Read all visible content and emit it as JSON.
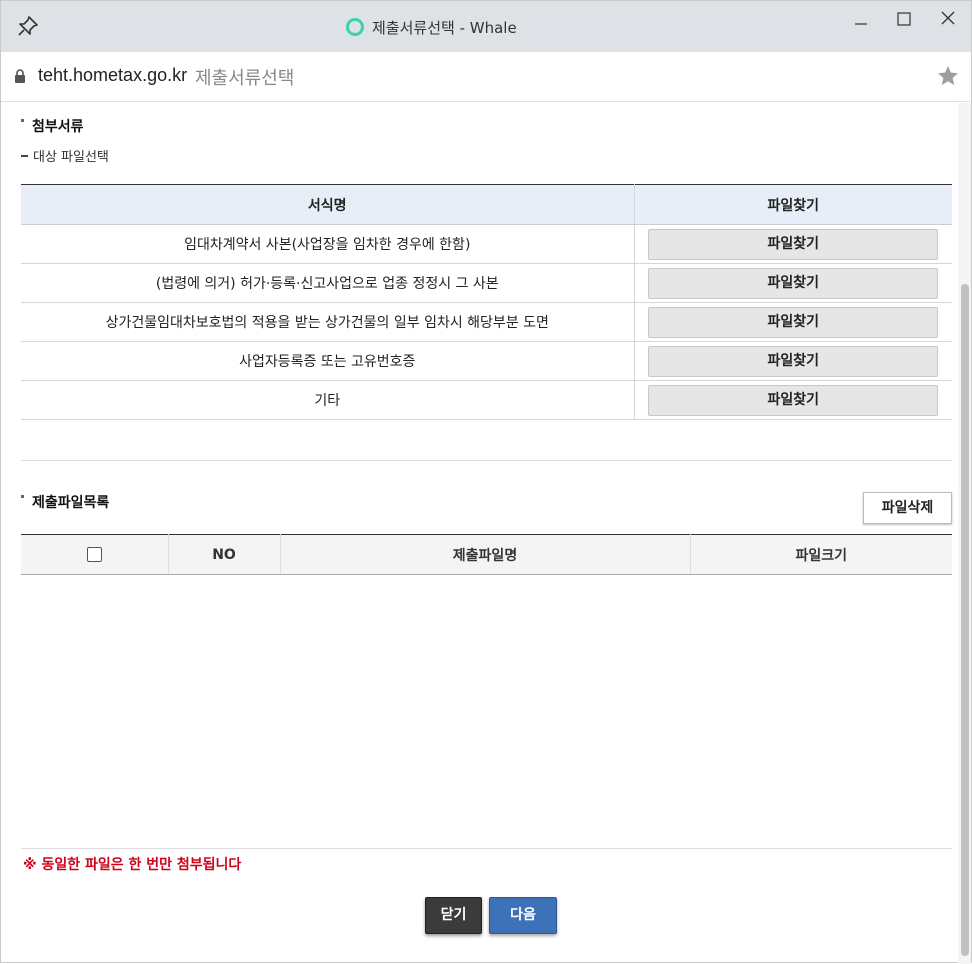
{
  "window": {
    "title": "제출서류선택 - Whale",
    "url": "teht.hometax.go.kr",
    "page_title": "제출서류선택"
  },
  "attach_section": {
    "title": "첨부서류",
    "subtitle": "대상 파일선택",
    "headers": [
      "서식명",
      "파일찾기"
    ],
    "rows": [
      {
        "name": "임대차계약서 사본(사업장을 임차한 경우에 한함)",
        "button": "파일찾기"
      },
      {
        "name": "(법령에 의거) 허가·등록·신고사업으로 업종 정정시 그 사본",
        "button": "파일찾기"
      },
      {
        "name": "상가건물임대차보호법의 적용을 받는 상가건물의 일부 임차시 해당부분 도면",
        "button": "파일찾기"
      },
      {
        "name": "사업자등록증 또는 고유번호증",
        "button": "파일찾기"
      },
      {
        "name": "기타",
        "button": "파일찾기"
      }
    ]
  },
  "file_section": {
    "title": "제출파일목록",
    "delete_label": "파일삭제",
    "headers": [
      "NO",
      "제출파일명",
      "파일크기"
    ],
    "rows": []
  },
  "notice": "※ 동일한 파일은 한 번만 첨부됩니다",
  "buttons": {
    "close": "닫기",
    "next": "다음"
  },
  "colors": {
    "accent_whale": "#3ad2ae",
    "notice_red": "#d0021b",
    "next_blue": "#3d72b9",
    "close_dark": "#3b3b3b"
  }
}
